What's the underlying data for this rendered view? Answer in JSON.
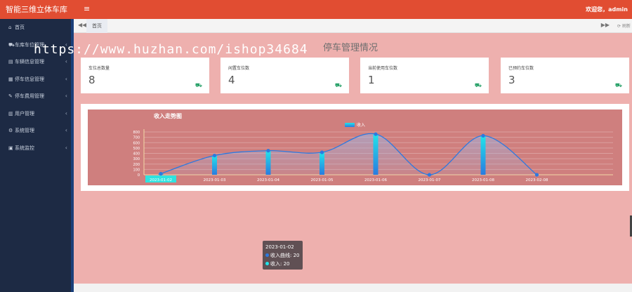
{
  "app": {
    "title": "智能三维立体车库"
  },
  "header": {
    "toggle_icon": "bars-icon",
    "user_text": "欢迎您，admin"
  },
  "sidebar": {
    "items": [
      {
        "label": "首页",
        "icon": "⌂",
        "has_chevron": false
      },
      {
        "label": "车库车位管理",
        "icon": "⛟",
        "has_chevron": true
      },
      {
        "label": "车辆信息管理",
        "icon": "▤",
        "has_chevron": true
      },
      {
        "label": "停车信息管理",
        "icon": "▦",
        "has_chevron": true
      },
      {
        "label": "停车费用管理",
        "icon": "✎",
        "has_chevron": true
      },
      {
        "label": "用户管理",
        "icon": "▥",
        "has_chevron": true
      },
      {
        "label": "系统管理",
        "icon": "⚙",
        "has_chevron": true
      },
      {
        "label": "系统监控",
        "icon": "▣",
        "has_chevron": true
      }
    ]
  },
  "tabs": {
    "home": "首页",
    "refresh": "刷新"
  },
  "watermark": "https://www.huzhan.com/ishop34684",
  "page": {
    "title": "停车管理情况"
  },
  "cards": [
    {
      "label": "车位总数量",
      "value": "8"
    },
    {
      "label": "闲置车位数",
      "value": "4"
    },
    {
      "label": "当前使用车位数",
      "value": "1"
    },
    {
      "label": "已预约车位数",
      "value": "3"
    }
  ],
  "chart_data": {
    "type": "bar",
    "title": "收入走势图",
    "categories": [
      "2023-01-02",
      "2023-01-03",
      "2023-01-04",
      "2023-01-05",
      "2023-01-06",
      "2023-01-07",
      "2023-01-08",
      "2023-02-08"
    ],
    "series": [
      {
        "name": "收入",
        "type": "bar",
        "values": [
          20,
          360,
          450,
          420,
          760,
          0,
          730,
          0
        ]
      },
      {
        "name": "收入曲线",
        "type": "line",
        "values": [
          20,
          360,
          450,
          420,
          760,
          0,
          730,
          0
        ]
      }
    ],
    "y_ticks": [
      0,
      100,
      200,
      300,
      400,
      500,
      600,
      700,
      800
    ],
    "ylim": [
      0,
      800
    ],
    "legend": "top-center",
    "grid": true,
    "highlighted_category": "2023-01-02",
    "tooltip": {
      "title": "2023-01-02",
      "rows": [
        {
          "name": "收入曲线",
          "value": "20"
        },
        {
          "name": "收入",
          "value": "20"
        }
      ]
    },
    "colors": {
      "background": "#cf7f7e",
      "bar_top": "#22e4ea",
      "bar_bottom": "#2a7be0",
      "line": "#2d79e0",
      "axis_text": "#ffffff"
    }
  },
  "colors": {
    "accent": "#e14d32",
    "sidebar": "#1d2a44",
    "content_bg": "#eeb0ae",
    "card_icon": "#2aa26a"
  }
}
